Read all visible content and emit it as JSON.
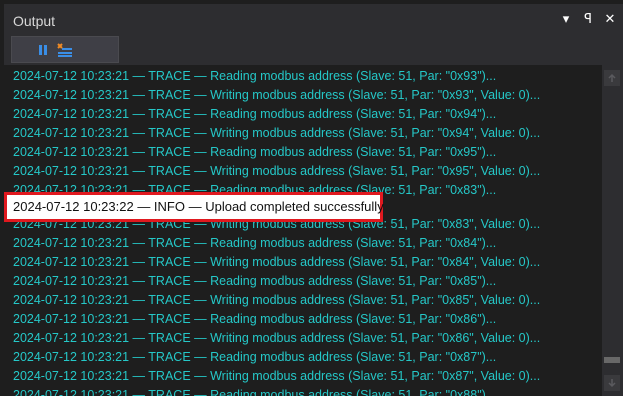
{
  "panel": {
    "title": "Output"
  },
  "title_controls": [
    {
      "name": "dropdown-arrow-icon",
      "glyph": "▾"
    },
    {
      "name": "pin-icon",
      "glyph": "ꟼ"
    },
    {
      "name": "close-icon",
      "glyph": "✕"
    }
  ],
  "toolbar": {
    "buttons": [
      {
        "name": "pause-icon",
        "active": true
      },
      {
        "name": "clear-output-icon",
        "active": false
      }
    ]
  },
  "log": {
    "lines": [
      "2024-07-12 10:23:21 — TRACE — Reading modbus address (Slave: 51, Par: \"0x93\")...",
      "2024-07-12 10:23:21 — TRACE — Writing modbus address (Slave: 51, Par: \"0x93\", Value: 0)...",
      "2024-07-12 10:23:21 — TRACE — Reading modbus address (Slave: 51, Par: \"0x94\")...",
      "2024-07-12 10:23:21 — TRACE — Writing modbus address (Slave: 51, Par: \"0x94\", Value: 0)...",
      "2024-07-12 10:23:21 — TRACE — Reading modbus address (Slave: 51, Par: \"0x95\")...",
      "2024-07-12 10:23:21 — TRACE — Writing modbus address (Slave: 51, Par: \"0x95\", Value: 0)...",
      "2024-07-12 10:23:21 — TRACE — Reading modbus address (Slave: 51, Par: \"0x83\")...",
      "2024-07-12 10:23:21 — TRACE — Writing modbus address (Slave: 51, Par: \"0x83\", Value: 0)...",
      "2024-07-12 10:23:21 — TRACE — Reading modbus address (Slave: 51, Par: \"0x84\")...",
      "2024-07-12 10:23:21 — TRACE — Writing modbus address (Slave: 51, Par: \"0x84\", Value: 0)...",
      "2024-07-12 10:23:21 — TRACE — Reading modbus address (Slave: 51, Par: \"0x85\")...",
      "2024-07-12 10:23:21 — TRACE — Writing modbus address (Slave: 51, Par: \"0x85\", Value: 0)...",
      "2024-07-12 10:23:21 — TRACE — Reading modbus address (Slave: 51, Par: \"0x86\")...",
      "2024-07-12 10:23:21 — TRACE — Writing modbus address (Slave: 51, Par: \"0x86\", Value: 0)...",
      "2024-07-12 10:23:21 — TRACE — Reading modbus address (Slave: 51, Par: \"0x87\")...",
      "2024-07-12 10:23:21 — TRACE — Writing modbus address (Slave: 51, Par: \"0x87\", Value: 0)...",
      "2024-07-12 10:23:21 — TRACE — Reading modbus address (Slave: 51, Par: \"0x88\")..."
    ],
    "highlighted": "2024-07-12 10:23:22 — INFO — Upload completed successfully"
  },
  "scrollbar": {
    "up_icon": "scroll-up-arrow-icon",
    "down_icon": "scroll-down-arrow-icon"
  },
  "colors": {
    "log_text": "#25c8c8",
    "background": "#1e1e1e",
    "highlight_border": "#e0191f"
  }
}
